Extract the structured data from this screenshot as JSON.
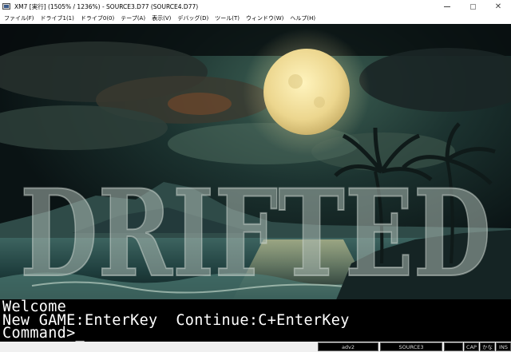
{
  "window": {
    "title": "XM7 [実行] (1505% / 1236%) - SOURCE3.D77 (SOURCE4.D77)",
    "controls": {
      "minimize": "–",
      "maximize": "□",
      "close": "✕"
    }
  },
  "menu": {
    "items": [
      {
        "label": "ファイル(F)"
      },
      {
        "label": "ドライブ1(1)"
      },
      {
        "label": "ドライブ0(0)"
      },
      {
        "label": "テープ(A)"
      },
      {
        "label": "表示(V)"
      },
      {
        "label": "デバッグ(D)"
      },
      {
        "label": "ツール(T)"
      },
      {
        "label": "ウィンドウ(W)"
      },
      {
        "label": "ヘルプ(H)"
      }
    ]
  },
  "screen": {
    "logo_text": "DRIFTED",
    "lines": [
      "Welcome",
      "New GAME:EnterKey  Continue:C+EnterKey",
      "Command>_"
    ],
    "colors": {
      "moon": "#efe0a0",
      "sky": "#0e1c1c",
      "sea": "#1f3d3d",
      "text": "#ffffff"
    }
  },
  "statusbar": {
    "cells": [
      {
        "label": ""
      },
      {
        "label": "adv2"
      },
      {
        "label": ""
      },
      {
        "label": "SOURCE3"
      },
      {
        "label": ""
      },
      {
        "label": "CAP"
      },
      {
        "label": "かな"
      },
      {
        "label": "INS"
      }
    ]
  }
}
